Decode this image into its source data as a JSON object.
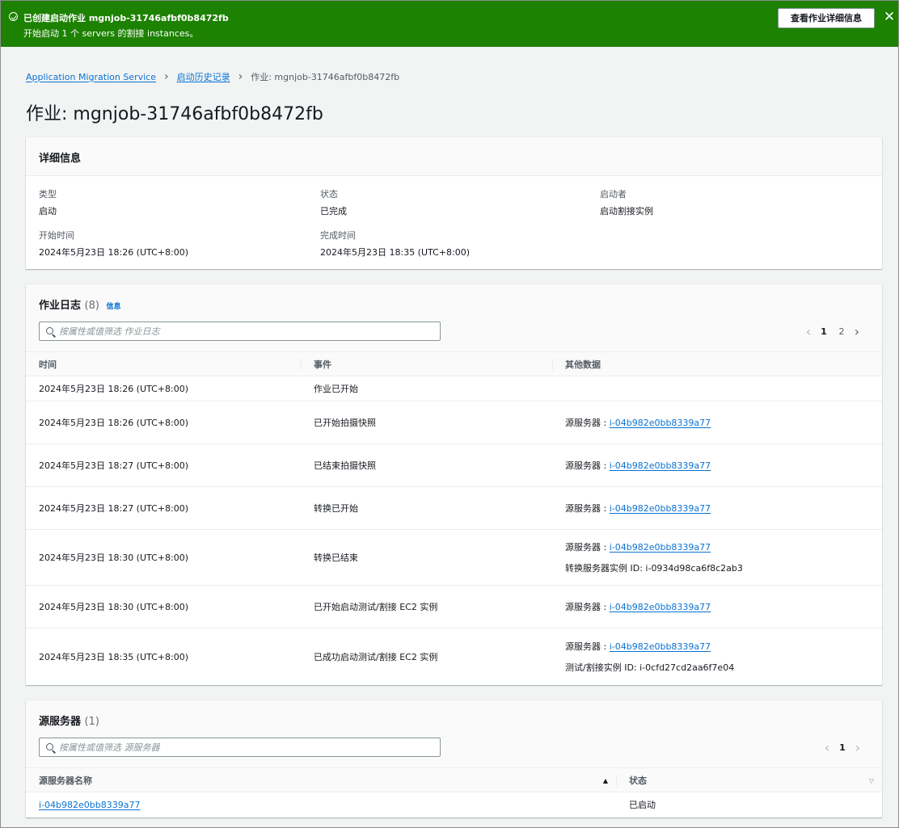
{
  "flash": {
    "title": "已创建启动作业 mgnjob-31746afbf0b8472fb",
    "message": "开始启动 1 个 servers 的割接 instances。",
    "button": "查看作业详细信息",
    "close_icon": "close-icon",
    "status_color": "#1d8102"
  },
  "breadcrumb": {
    "items": [
      "Application Migration Service",
      "启动历史记录"
    ],
    "current": "作业: mgnjob-31746afbf0b8472fb"
  },
  "page_title": "作业: mgnjob-31746afbf0b8472fb",
  "details": {
    "title": "详细信息",
    "type_label": "类型",
    "type_value": "启动",
    "status_label": "状态",
    "status_value": "已完成",
    "initiator_label": "启动者",
    "initiator_value": "启动割接实例",
    "start_label": "开始时间",
    "start_value": "2024年5月23日 18:26 (UTC+8:00)",
    "end_label": "完成时间",
    "end_value": "2024年5月23日 18:35 (UTC+8:00)"
  },
  "job_log": {
    "title": "作业日志",
    "count": "(8)",
    "info": "信息",
    "filter_placeholder": "按属性或值筛选 作业日志",
    "pages": [
      "1",
      "2"
    ],
    "current_page": "1",
    "columns": [
      "时间",
      "事件",
      "其他数据"
    ],
    "rows": [
      {
        "time": "2024年5月23日 18:26 (UTC+8:00)",
        "event": "作业已开始",
        "extra_label": "",
        "extra_link": "",
        "extra2": ""
      },
      {
        "time": "2024年5月23日 18:26 (UTC+8:00)",
        "event": "已开始拍摄快照",
        "extra_label": "源服务器 : ",
        "extra_link": "i-04b982e0bb8339a77",
        "extra2": ""
      },
      {
        "time": "2024年5月23日 18:27 (UTC+8:00)",
        "event": "已结束拍摄快照",
        "extra_label": "源服务器 : ",
        "extra_link": "i-04b982e0bb8339a77",
        "extra2": ""
      },
      {
        "time": "2024年5月23日 18:27 (UTC+8:00)",
        "event": "转换已开始",
        "extra_label": "源服务器 : ",
        "extra_link": "i-04b982e0bb8339a77",
        "extra2": ""
      },
      {
        "time": "2024年5月23日 18:30 (UTC+8:00)",
        "event": "转换已结束",
        "extra_label": "源服务器 : ",
        "extra_link": "i-04b982e0bb8339a77",
        "extra2": "转换服务器实例 ID: i-0934d98ca6f8c2ab3"
      },
      {
        "time": "2024年5月23日 18:30 (UTC+8:00)",
        "event": "已开始启动测试/割接 EC2 实例",
        "extra_label": "源服务器 : ",
        "extra_link": "i-04b982e0bb8339a77",
        "extra2": ""
      },
      {
        "time": "2024年5月23日 18:35 (UTC+8:00)",
        "event": "已成功启动测试/割接 EC2 实例",
        "extra_label": "源服务器 : ",
        "extra_link": "i-04b982e0bb8339a77",
        "extra2": "测试/割接实例 ID: i-0cfd27cd2aa6f7e04"
      }
    ]
  },
  "source_servers": {
    "title": "源服务器",
    "count": "(1)",
    "filter_placeholder": "按属性或值筛选 源服务器",
    "pages": [
      "1"
    ],
    "current_page": "1",
    "columns": [
      "源服务器名称",
      "状态"
    ],
    "rows": [
      {
        "name": "i-04b982e0bb8339a77",
        "status": "已启动"
      }
    ]
  }
}
